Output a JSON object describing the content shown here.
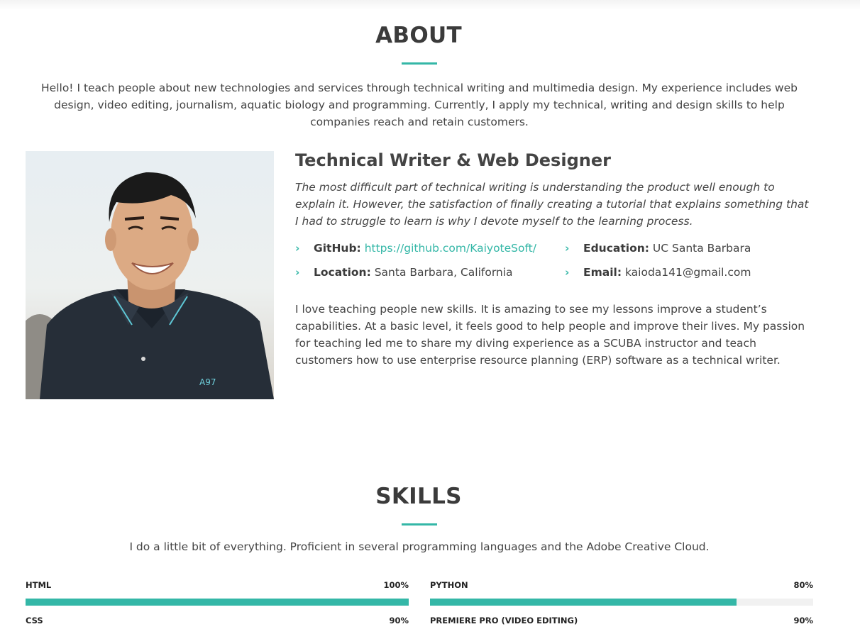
{
  "about": {
    "title": "ABOUT",
    "intro": "Hello! I teach people about new technologies and services through technical writing and multimedia design. My experience includes web design, video editing, journalism, aquatic biology and programming. Currently, I apply my technical, writing and design skills to help companies reach and retain customers.",
    "role": "Technical Writer & Web Designer",
    "quote": "The most difficult part of technical writing is understanding the product well enough to explain it. However, the satisfaction of finally creating a tutorial that explains something that I had to struggle to learn is why I devote myself to the learning process.",
    "info": {
      "github_label": "GitHub:",
      "github_value": "https://github.com/KaiyoteSoft/",
      "education_label": "Education:",
      "education_value": "UC Santa Barbara",
      "location_label": "Location:",
      "location_value": "Santa Barbara, California",
      "email_label": "Email:",
      "email_value": "kaioda141@gmail.com"
    },
    "bio": "I love teaching people new skills. It is amazing to see my lessons improve a student’s capabilities. At a basic level, it feels good to help people and improve their lives. My passion for teaching led me to share my diving experience as a SCUBA instructor and teach customers how to use enterprise resource planning (ERP) software as a technical writer."
  },
  "skills": {
    "title": "SKILLS",
    "intro": "I do a little bit of everything. Proficient in several programming languages and the Adobe Creative Cloud.",
    "items": [
      {
        "name": "HTML",
        "percent_label": "100%",
        "level": 100
      },
      {
        "name": "PYTHON",
        "percent_label": "80%",
        "level": 80
      },
      {
        "name": "CSS",
        "percent_label": "90%",
        "level": 90
      },
      {
        "name": "PREMIERE PRO (VIDEO EDITING)",
        "percent_label": "90%",
        "level": 90
      }
    ]
  },
  "colors": {
    "accent": "#34b7a7",
    "heading": "#3b3b3b",
    "text": "#444444"
  }
}
